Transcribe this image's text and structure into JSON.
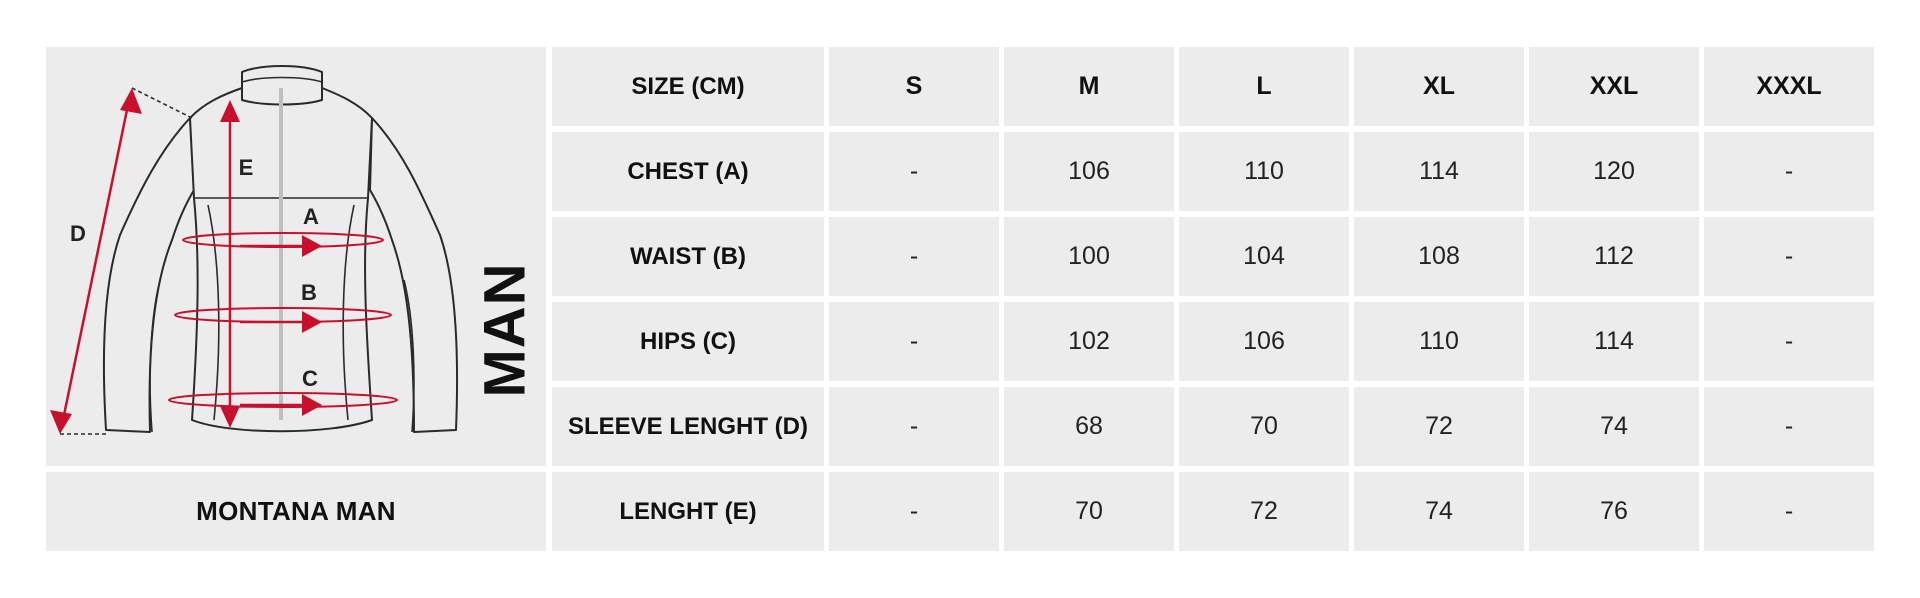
{
  "product_name": "MONTANA MAN",
  "gender_label": "MAN",
  "diagram_labels": {
    "a": "A",
    "b": "B",
    "c": "C",
    "d": "D",
    "e": "E"
  },
  "colors": {
    "accent": "#c8102e",
    "cell_bg": "#ececec",
    "outline": "#2a2a2a"
  },
  "icons": [
    "jacket-outline-icon",
    "measurement-arrow-icon"
  ],
  "table": {
    "header_label": "SIZE (CM)",
    "sizes": [
      "S",
      "M",
      "L",
      "XL",
      "XXL",
      "XXXL"
    ],
    "rows": [
      {
        "label": "CHEST (A)",
        "values": [
          "-",
          "106",
          "110",
          "114",
          "120",
          "-"
        ]
      },
      {
        "label": "WAIST (B)",
        "values": [
          "-",
          "100",
          "104",
          "108",
          "112",
          "-"
        ]
      },
      {
        "label": "HIPS (C)",
        "values": [
          "-",
          "102",
          "106",
          "110",
          "114",
          "-"
        ]
      },
      {
        "label": "SLEEVE LENGHT (D)",
        "values": [
          "-",
          "68",
          "70",
          "72",
          "74",
          "-"
        ]
      },
      {
        "label": "LENGHT (E)",
        "values": [
          "-",
          "70",
          "72",
          "74",
          "76",
          "-"
        ]
      }
    ]
  }
}
